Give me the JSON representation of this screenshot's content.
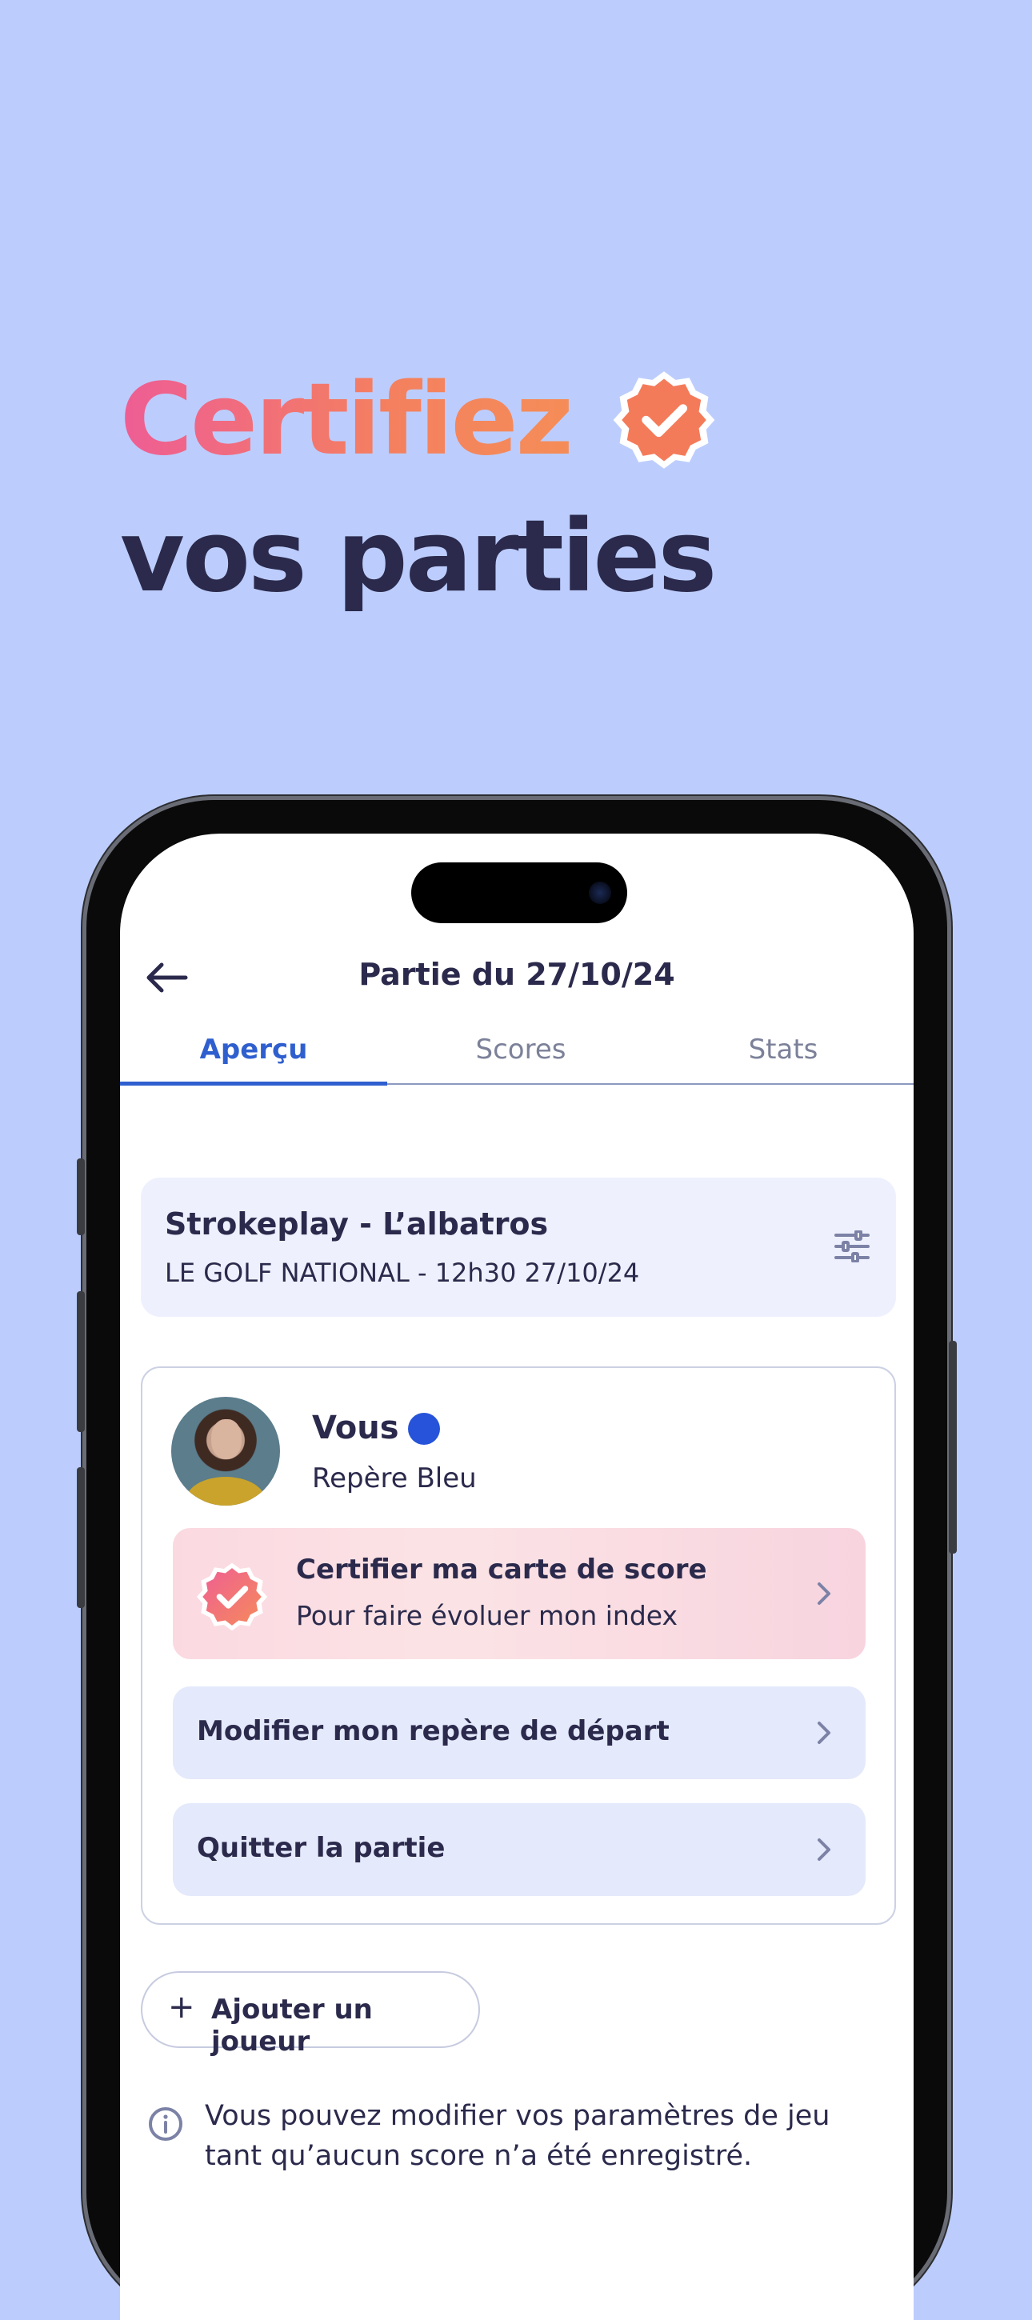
{
  "headline": {
    "line1": "Certifiez",
    "line2": "vos parties",
    "badge_icon": "verified-badge-icon"
  },
  "header": {
    "back_icon": "arrow-left-icon",
    "title": "Partie du 27/10/24"
  },
  "tabs": [
    {
      "label": "Aperçu",
      "active": true
    },
    {
      "label": "Scores",
      "active": false
    },
    {
      "label": "Stats",
      "active": false
    }
  ],
  "game": {
    "title": "Strokeplay - L’albatros",
    "subtitle": "LE GOLF NATIONAL - 12h30 27/10/24",
    "settings_icon": "sliders-icon"
  },
  "player": {
    "name": "Vous",
    "tee": "Repère Bleu",
    "tee_color": "#2653d9",
    "actions": {
      "certify_title": "Certifier ma carte de score",
      "certify_subtitle": "Pour faire évoluer mon index",
      "change_tee": "Modifier mon repère de départ",
      "leave": "Quitter la partie"
    }
  },
  "add_player": {
    "icon": "+",
    "label": "Ajouter un joueur"
  },
  "info": {
    "icon": "info-icon",
    "text": "Vous pouvez modifier vos paramètres de jeu tant qu’aucun score n’a été enregistré."
  },
  "colors": {
    "background": "#bccdfd",
    "accent": "#2f5fcf",
    "text": "#2b2a4c",
    "badge": "#f4805f"
  }
}
